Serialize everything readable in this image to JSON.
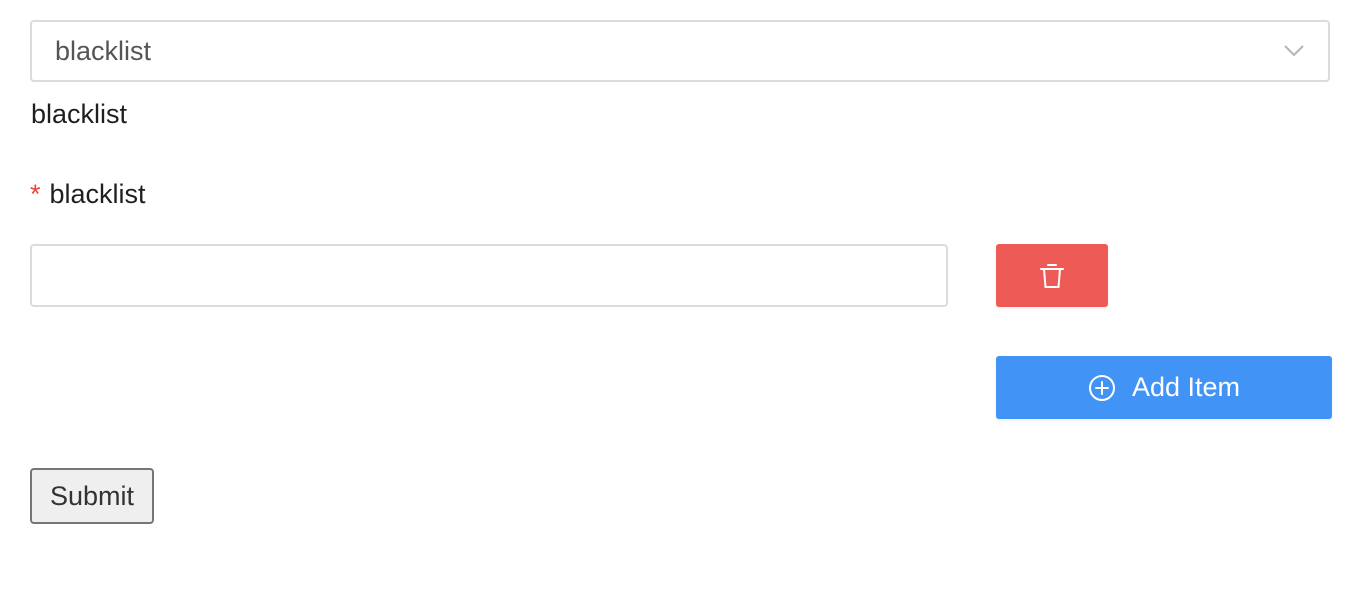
{
  "select": {
    "value": "blacklist"
  },
  "field": {
    "caption": "blacklist",
    "required_marker": "*",
    "label": "blacklist",
    "input_value": "",
    "input_placeholder": ""
  },
  "buttons": {
    "delete_icon": "trash-icon",
    "add_label": "Add Item",
    "add_icon": "plus-circle-icon",
    "submit_label": "Submit"
  },
  "colors": {
    "delete": "#ee5b56",
    "add": "#4194f6",
    "required": "#e8453c"
  }
}
